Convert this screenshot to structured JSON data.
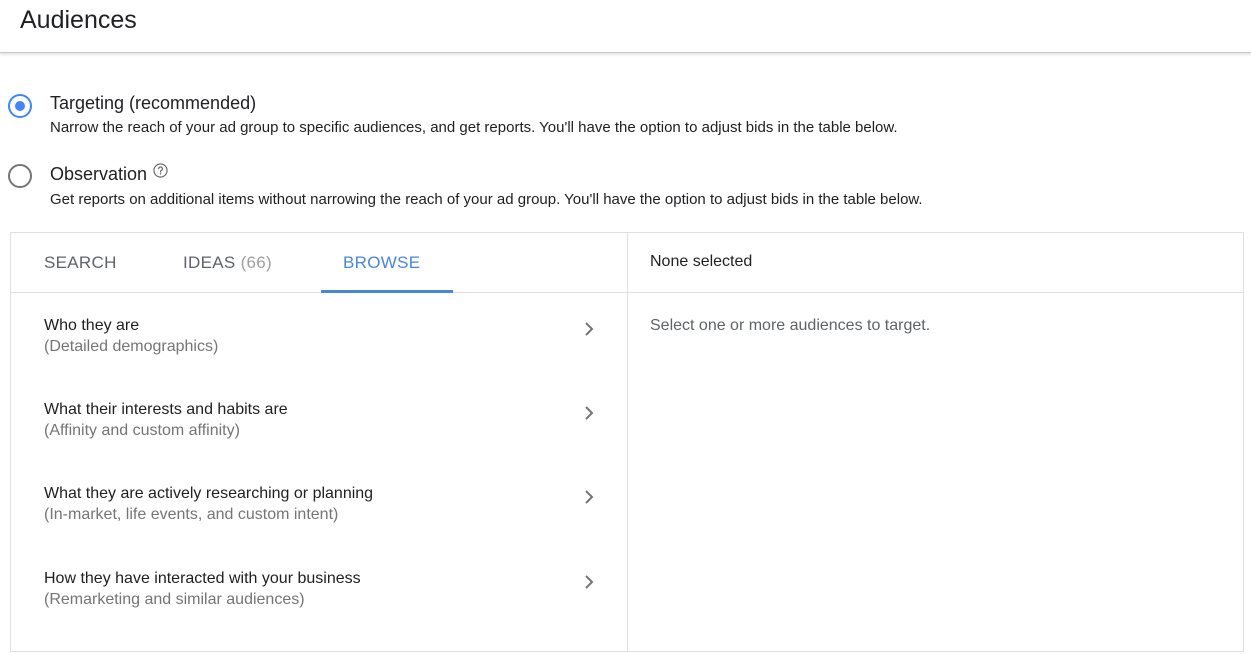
{
  "header": {
    "title": "Audiences"
  },
  "targeting_options": [
    {
      "label": "Targeting (recommended)",
      "description": "Narrow the reach of your ad group to specific audiences, and get reports. You'll have the option to adjust bids in the table below.",
      "selected": true
    },
    {
      "label": "Observation",
      "description": "Get reports on additional items without narrowing the reach of your ad group. You'll have the option to adjust bids in the table below.",
      "selected": false,
      "icon": "help-icon"
    }
  ],
  "tabs": [
    {
      "label": "SEARCH",
      "active": false
    },
    {
      "label": "IDEAS",
      "count": "(66)",
      "active": false
    },
    {
      "label": "BROWSE",
      "active": true
    }
  ],
  "browse_items": [
    {
      "title": "Who they are",
      "subtitle": "(Detailed demographics)",
      "icon": "chevron-right-icon"
    },
    {
      "title": "What their interests and habits are",
      "subtitle": "(Affinity and custom affinity)",
      "icon": "chevron-right-icon"
    },
    {
      "title": "What they are actively researching or planning",
      "subtitle": "(In-market, life events, and custom intent)",
      "icon": "chevron-right-icon"
    },
    {
      "title": "How they have interacted with your business",
      "subtitle": "(Remarketing and similar audiences)",
      "icon": "chevron-right-icon"
    }
  ],
  "selection_panel": {
    "header": "None selected",
    "hint": "Select one or more audiences to target."
  },
  "colors": {
    "accent": "#4a86d8",
    "radio_selected": "#4285f4",
    "border": "#e0e0e0",
    "muted_text": "#757575"
  }
}
